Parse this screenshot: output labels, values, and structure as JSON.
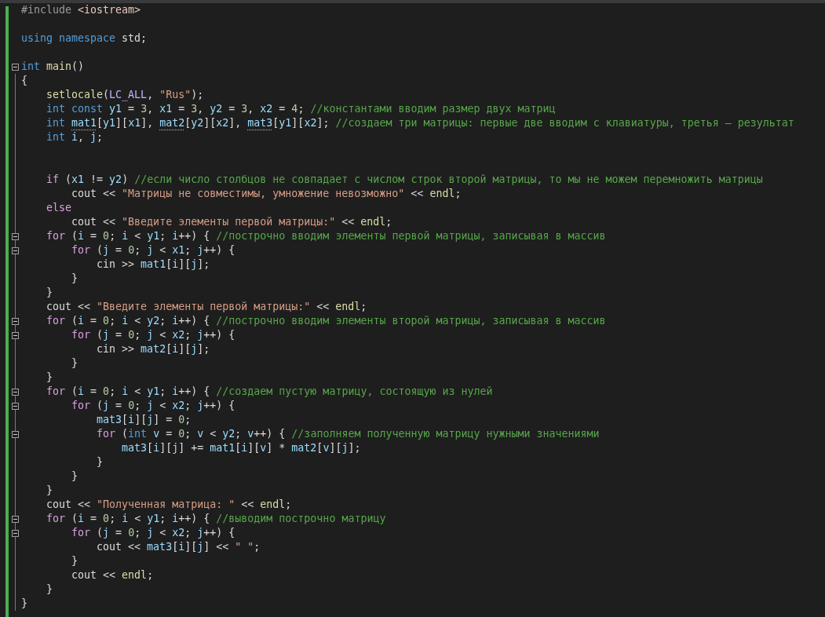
{
  "editor": {
    "lines": [
      {
        "fold": false,
        "tokens": [
          {
            "kind": "pre",
            "text": "#include "
          },
          {
            "kind": "inc",
            "text": "<iostream>"
          }
        ]
      },
      {
        "fold": false
      },
      {
        "fold": false,
        "tokens": [
          {
            "kind": "kw",
            "text": "using namespace"
          },
          {
            "kind": "p",
            "text": " std;"
          }
        ]
      },
      {
        "fold": false
      },
      {
        "fold": true,
        "tokens": [
          {
            "kind": "kw",
            "text": "int "
          },
          {
            "kind": "fn",
            "text": "main"
          },
          {
            "kind": "p",
            "text": "()"
          }
        ]
      },
      {
        "fold": false,
        "tokens": [
          {
            "kind": "p",
            "text": "{"
          }
        ]
      },
      {
        "fold": false,
        "tokens": [
          {
            "kind": "fn",
            "text": "    setlocale"
          },
          {
            "kind": "p",
            "text": "("
          },
          {
            "kind": "mac",
            "text": "LC_ALL"
          },
          {
            "kind": "p",
            "text": ", "
          },
          {
            "kind": "str",
            "text": "\"Rus\""
          },
          {
            "kind": "p",
            "text": ");"
          }
        ]
      },
      {
        "fold": false,
        "tokens": [
          {
            "kind": "kw",
            "text": "    int const "
          },
          {
            "kind": "var",
            "text": "y1"
          },
          {
            "kind": "p",
            "text": " = "
          },
          {
            "kind": "num",
            "text": "3"
          },
          {
            "kind": "p",
            "text": ", "
          },
          {
            "kind": "var",
            "text": "x1"
          },
          {
            "kind": "p",
            "text": " = "
          },
          {
            "kind": "num",
            "text": "3"
          },
          {
            "kind": "p",
            "text": ", "
          },
          {
            "kind": "var",
            "text": "y2"
          },
          {
            "kind": "p",
            "text": " = "
          },
          {
            "kind": "num",
            "text": "3"
          },
          {
            "kind": "p",
            "text": ", "
          },
          {
            "kind": "var",
            "text": "x2"
          },
          {
            "kind": "p",
            "text": " = "
          },
          {
            "kind": "num",
            "text": "4"
          },
          {
            "kind": "p",
            "text": "; "
          },
          {
            "kind": "cmt",
            "text": "//константами вводим размер двух матриц"
          }
        ]
      },
      {
        "fold": false,
        "tokens": [
          {
            "kind": "kw",
            "text": "    int "
          },
          {
            "kind": "var",
            "text": "mat1",
            "hint": true
          },
          {
            "kind": "p",
            "text": "["
          },
          {
            "kind": "var",
            "text": "y1"
          },
          {
            "kind": "p",
            "text": "]["
          },
          {
            "kind": "var",
            "text": "x1"
          },
          {
            "kind": "p",
            "text": "], "
          },
          {
            "kind": "var",
            "text": "mat2",
            "hint": true
          },
          {
            "kind": "p",
            "text": "["
          },
          {
            "kind": "var",
            "text": "y2"
          },
          {
            "kind": "p",
            "text": "]["
          },
          {
            "kind": "var",
            "text": "x2"
          },
          {
            "kind": "p",
            "text": "], "
          },
          {
            "kind": "var",
            "text": "mat3",
            "hint": true
          },
          {
            "kind": "p",
            "text": "["
          },
          {
            "kind": "var",
            "text": "y1"
          },
          {
            "kind": "p",
            "text": "]["
          },
          {
            "kind": "var",
            "text": "x2"
          },
          {
            "kind": "p",
            "text": "]; "
          },
          {
            "kind": "cmt",
            "text": "//создаем три матрицы: первые две вводим с клавиатуры, третья – результат"
          }
        ]
      },
      {
        "fold": false,
        "tokens": [
          {
            "kind": "kw",
            "text": "    int "
          },
          {
            "kind": "var",
            "text": "i"
          },
          {
            "kind": "p",
            "text": ", "
          },
          {
            "kind": "var",
            "text": "j"
          },
          {
            "kind": "p",
            "text": ";"
          }
        ]
      },
      {
        "fold": false
      },
      {
        "fold": false
      },
      {
        "fold": false,
        "tokens": [
          {
            "kind": "ctl",
            "text": "    if"
          },
          {
            "kind": "p",
            "text": " ("
          },
          {
            "kind": "var",
            "text": "x1"
          },
          {
            "kind": "p",
            "text": " != "
          },
          {
            "kind": "var",
            "text": "y2"
          },
          {
            "kind": "p",
            "text": ") "
          },
          {
            "kind": "cmt",
            "text": "//если число столбцов не совпадает с числом строк второй матрицы, то мы не можем перемножить матрицы"
          }
        ]
      },
      {
        "fold": false,
        "tokens": [
          {
            "kind": "p",
            "text": "        cout << "
          },
          {
            "kind": "str",
            "text": "\"Матрицы не совместимы, умножение невозможно\""
          },
          {
            "kind": "p",
            "text": " << "
          },
          {
            "kind": "fn",
            "text": "endl"
          },
          {
            "kind": "p",
            "text": ";"
          }
        ]
      },
      {
        "fold": false,
        "tokens": [
          {
            "kind": "ctl",
            "text": "    else"
          }
        ]
      },
      {
        "fold": false,
        "tokens": [
          {
            "kind": "p",
            "text": "        cout << "
          },
          {
            "kind": "str",
            "text": "\"Введите элементы первой матрицы:\""
          },
          {
            "kind": "p",
            "text": " << "
          },
          {
            "kind": "fn",
            "text": "endl"
          },
          {
            "kind": "p",
            "text": ";"
          }
        ]
      },
      {
        "fold": true,
        "tokens": [
          {
            "kind": "ctl",
            "text": "    for"
          },
          {
            "kind": "p",
            "text": " ("
          },
          {
            "kind": "var",
            "text": "i"
          },
          {
            "kind": "p",
            "text": " = "
          },
          {
            "kind": "num",
            "text": "0"
          },
          {
            "kind": "p",
            "text": "; "
          },
          {
            "kind": "var",
            "text": "i"
          },
          {
            "kind": "p",
            "text": " < "
          },
          {
            "kind": "var",
            "text": "y1"
          },
          {
            "kind": "p",
            "text": "; "
          },
          {
            "kind": "var",
            "text": "i"
          },
          {
            "kind": "p",
            "text": "++) { "
          },
          {
            "kind": "cmt",
            "text": "//построчно вводим элементы первой матрицы, записывая в массив"
          }
        ]
      },
      {
        "fold": true,
        "tokens": [
          {
            "kind": "ctl",
            "text": "        for"
          },
          {
            "kind": "p",
            "text": " ("
          },
          {
            "kind": "var",
            "text": "j"
          },
          {
            "kind": "p",
            "text": " = "
          },
          {
            "kind": "num",
            "text": "0"
          },
          {
            "kind": "p",
            "text": "; "
          },
          {
            "kind": "var",
            "text": "j"
          },
          {
            "kind": "p",
            "text": " < "
          },
          {
            "kind": "var",
            "text": "x1"
          },
          {
            "kind": "p",
            "text": "; "
          },
          {
            "kind": "var",
            "text": "j"
          },
          {
            "kind": "p",
            "text": "++) {"
          }
        ]
      },
      {
        "fold": false,
        "tokens": [
          {
            "kind": "p",
            "text": "            cin >> "
          },
          {
            "kind": "var",
            "text": "mat1"
          },
          {
            "kind": "p",
            "text": "["
          },
          {
            "kind": "var",
            "text": "i"
          },
          {
            "kind": "p",
            "text": "]["
          },
          {
            "kind": "var",
            "text": "j"
          },
          {
            "kind": "p",
            "text": "];"
          }
        ]
      },
      {
        "fold": false,
        "tokens": [
          {
            "kind": "p",
            "text": "        }"
          }
        ]
      },
      {
        "fold": false,
        "tokens": [
          {
            "kind": "p",
            "text": "    }"
          }
        ]
      },
      {
        "fold": false,
        "tokens": [
          {
            "kind": "p",
            "text": "    cout << "
          },
          {
            "kind": "str",
            "text": "\"Введите элементы первой матрицы:\""
          },
          {
            "kind": "p",
            "text": " << "
          },
          {
            "kind": "fn",
            "text": "endl"
          },
          {
            "kind": "p",
            "text": ";"
          }
        ]
      },
      {
        "fold": true,
        "tokens": [
          {
            "kind": "ctl",
            "text": "    for"
          },
          {
            "kind": "p",
            "text": " ("
          },
          {
            "kind": "var",
            "text": "i"
          },
          {
            "kind": "p",
            "text": " = "
          },
          {
            "kind": "num",
            "text": "0"
          },
          {
            "kind": "p",
            "text": "; "
          },
          {
            "kind": "var",
            "text": "i"
          },
          {
            "kind": "p",
            "text": " < "
          },
          {
            "kind": "var",
            "text": "y2"
          },
          {
            "kind": "p",
            "text": "; "
          },
          {
            "kind": "var",
            "text": "i"
          },
          {
            "kind": "p",
            "text": "++) { "
          },
          {
            "kind": "cmt",
            "text": "//построчно вводим элементы второй матрицы, записывая в массив"
          }
        ]
      },
      {
        "fold": true,
        "tokens": [
          {
            "kind": "ctl",
            "text": "        for"
          },
          {
            "kind": "p",
            "text": " ("
          },
          {
            "kind": "var",
            "text": "j"
          },
          {
            "kind": "p",
            "text": " = "
          },
          {
            "kind": "num",
            "text": "0"
          },
          {
            "kind": "p",
            "text": "; "
          },
          {
            "kind": "var",
            "text": "j"
          },
          {
            "kind": "p",
            "text": " < "
          },
          {
            "kind": "var",
            "text": "x2"
          },
          {
            "kind": "p",
            "text": "; "
          },
          {
            "kind": "var",
            "text": "j"
          },
          {
            "kind": "p",
            "text": "++) {"
          }
        ]
      },
      {
        "fold": false,
        "tokens": [
          {
            "kind": "p",
            "text": "            cin >> "
          },
          {
            "kind": "var",
            "text": "mat2"
          },
          {
            "kind": "p",
            "text": "["
          },
          {
            "kind": "var",
            "text": "i"
          },
          {
            "kind": "p",
            "text": "]["
          },
          {
            "kind": "var",
            "text": "j"
          },
          {
            "kind": "p",
            "text": "];"
          }
        ]
      },
      {
        "fold": false,
        "tokens": [
          {
            "kind": "p",
            "text": "        }"
          }
        ]
      },
      {
        "fold": false,
        "tokens": [
          {
            "kind": "p",
            "text": "    }"
          }
        ]
      },
      {
        "fold": true,
        "tokens": [
          {
            "kind": "ctl",
            "text": "    for"
          },
          {
            "kind": "p",
            "text": " ("
          },
          {
            "kind": "var",
            "text": "i"
          },
          {
            "kind": "p",
            "text": " = "
          },
          {
            "kind": "num",
            "text": "0"
          },
          {
            "kind": "p",
            "text": "; "
          },
          {
            "kind": "var",
            "text": "i"
          },
          {
            "kind": "p",
            "text": " < "
          },
          {
            "kind": "var",
            "text": "y1"
          },
          {
            "kind": "p",
            "text": "; "
          },
          {
            "kind": "var",
            "text": "i"
          },
          {
            "kind": "p",
            "text": "++) { "
          },
          {
            "kind": "cmt",
            "text": "//создаем пустую матрицу, состоящую из нулей"
          }
        ]
      },
      {
        "fold": true,
        "tokens": [
          {
            "kind": "ctl",
            "text": "        for"
          },
          {
            "kind": "p",
            "text": " ("
          },
          {
            "kind": "var",
            "text": "j"
          },
          {
            "kind": "p",
            "text": " = "
          },
          {
            "kind": "num",
            "text": "0"
          },
          {
            "kind": "p",
            "text": "; "
          },
          {
            "kind": "var",
            "text": "j"
          },
          {
            "kind": "p",
            "text": " < "
          },
          {
            "kind": "var",
            "text": "x2"
          },
          {
            "kind": "p",
            "text": "; "
          },
          {
            "kind": "var",
            "text": "j"
          },
          {
            "kind": "p",
            "text": "++) {"
          }
        ]
      },
      {
        "fold": false,
        "tokens": [
          {
            "kind": "var",
            "text": "            mat3"
          },
          {
            "kind": "p",
            "text": "["
          },
          {
            "kind": "var",
            "text": "i"
          },
          {
            "kind": "p",
            "text": "]["
          },
          {
            "kind": "var",
            "text": "j"
          },
          {
            "kind": "p",
            "text": "] = "
          },
          {
            "kind": "num",
            "text": "0"
          },
          {
            "kind": "p",
            "text": ";"
          }
        ]
      },
      {
        "fold": true,
        "tokens": [
          {
            "kind": "ctl",
            "text": "            for"
          },
          {
            "kind": "p",
            "text": " ("
          },
          {
            "kind": "kw",
            "text": "int "
          },
          {
            "kind": "var",
            "text": "v"
          },
          {
            "kind": "p",
            "text": " = "
          },
          {
            "kind": "num",
            "text": "0"
          },
          {
            "kind": "p",
            "text": "; "
          },
          {
            "kind": "var",
            "text": "v"
          },
          {
            "kind": "p",
            "text": " < "
          },
          {
            "kind": "var",
            "text": "y2"
          },
          {
            "kind": "p",
            "text": "; "
          },
          {
            "kind": "var",
            "text": "v"
          },
          {
            "kind": "p",
            "text": "++) { "
          },
          {
            "kind": "cmt",
            "text": "//заполняем полученную матрицу нужными значениями"
          }
        ]
      },
      {
        "fold": false,
        "tokens": [
          {
            "kind": "var",
            "text": "                mat3"
          },
          {
            "kind": "p",
            "text": "["
          },
          {
            "kind": "var",
            "text": "i"
          },
          {
            "kind": "p",
            "text": "]["
          },
          {
            "kind": "var",
            "text": "j"
          },
          {
            "kind": "p",
            "text": "] += "
          },
          {
            "kind": "var",
            "text": "mat1"
          },
          {
            "kind": "p",
            "text": "["
          },
          {
            "kind": "var",
            "text": "i"
          },
          {
            "kind": "p",
            "text": "]["
          },
          {
            "kind": "var",
            "text": "v"
          },
          {
            "kind": "p",
            "text": "] * "
          },
          {
            "kind": "var",
            "text": "mat2"
          },
          {
            "kind": "p",
            "text": "["
          },
          {
            "kind": "var",
            "text": "v"
          },
          {
            "kind": "p",
            "text": "]["
          },
          {
            "kind": "var",
            "text": "j"
          },
          {
            "kind": "p",
            "text": "];"
          }
        ]
      },
      {
        "fold": false,
        "tokens": [
          {
            "kind": "p",
            "text": "            }"
          }
        ]
      },
      {
        "fold": false,
        "tokens": [
          {
            "kind": "p",
            "text": "        }"
          }
        ]
      },
      {
        "fold": false,
        "tokens": [
          {
            "kind": "p",
            "text": "    }"
          }
        ]
      },
      {
        "fold": false,
        "tokens": [
          {
            "kind": "p",
            "text": "    cout << "
          },
          {
            "kind": "str",
            "text": "\"Полученная матрица: \""
          },
          {
            "kind": "p",
            "text": " << "
          },
          {
            "kind": "fn",
            "text": "endl"
          },
          {
            "kind": "p",
            "text": ";"
          }
        ]
      },
      {
        "fold": true,
        "tokens": [
          {
            "kind": "ctl",
            "text": "    for"
          },
          {
            "kind": "p",
            "text": " ("
          },
          {
            "kind": "var",
            "text": "i"
          },
          {
            "kind": "p",
            "text": " = "
          },
          {
            "kind": "num",
            "text": "0"
          },
          {
            "kind": "p",
            "text": "; "
          },
          {
            "kind": "var",
            "text": "i"
          },
          {
            "kind": "p",
            "text": " < "
          },
          {
            "kind": "var",
            "text": "y1"
          },
          {
            "kind": "p",
            "text": "; "
          },
          {
            "kind": "var",
            "text": "i"
          },
          {
            "kind": "p",
            "text": "++) { "
          },
          {
            "kind": "cmt",
            "text": "//выводим построчно матрицу"
          }
        ]
      },
      {
        "fold": true,
        "tokens": [
          {
            "kind": "ctl",
            "text": "        for"
          },
          {
            "kind": "p",
            "text": " ("
          },
          {
            "kind": "var",
            "text": "j"
          },
          {
            "kind": "p",
            "text": " = "
          },
          {
            "kind": "num",
            "text": "0"
          },
          {
            "kind": "p",
            "text": "; "
          },
          {
            "kind": "var",
            "text": "j"
          },
          {
            "kind": "p",
            "text": " < "
          },
          {
            "kind": "var",
            "text": "x2"
          },
          {
            "kind": "p",
            "text": "; "
          },
          {
            "kind": "var",
            "text": "j"
          },
          {
            "kind": "p",
            "text": "++) {"
          }
        ]
      },
      {
        "fold": false,
        "tokens": [
          {
            "kind": "p",
            "text": "            cout << "
          },
          {
            "kind": "var",
            "text": "mat3"
          },
          {
            "kind": "p",
            "text": "["
          },
          {
            "kind": "var",
            "text": "i"
          },
          {
            "kind": "p",
            "text": "]["
          },
          {
            "kind": "var",
            "text": "j"
          },
          {
            "kind": "p",
            "text": "] << "
          },
          {
            "kind": "str",
            "text": "\" \""
          },
          {
            "kind": "p",
            "text": ";"
          }
        ]
      },
      {
        "fold": false,
        "tokens": [
          {
            "kind": "p",
            "text": "        }"
          }
        ]
      },
      {
        "fold": false,
        "tokens": [
          {
            "kind": "p",
            "text": "        cout << "
          },
          {
            "kind": "fn",
            "text": "endl"
          },
          {
            "kind": "p",
            "text": ";"
          }
        ]
      },
      {
        "fold": false,
        "tokens": [
          {
            "kind": "p",
            "text": "    }"
          }
        ]
      },
      {
        "fold": false,
        "tokens": [
          {
            "kind": "p",
            "text": "}"
          }
        ]
      }
    ]
  }
}
